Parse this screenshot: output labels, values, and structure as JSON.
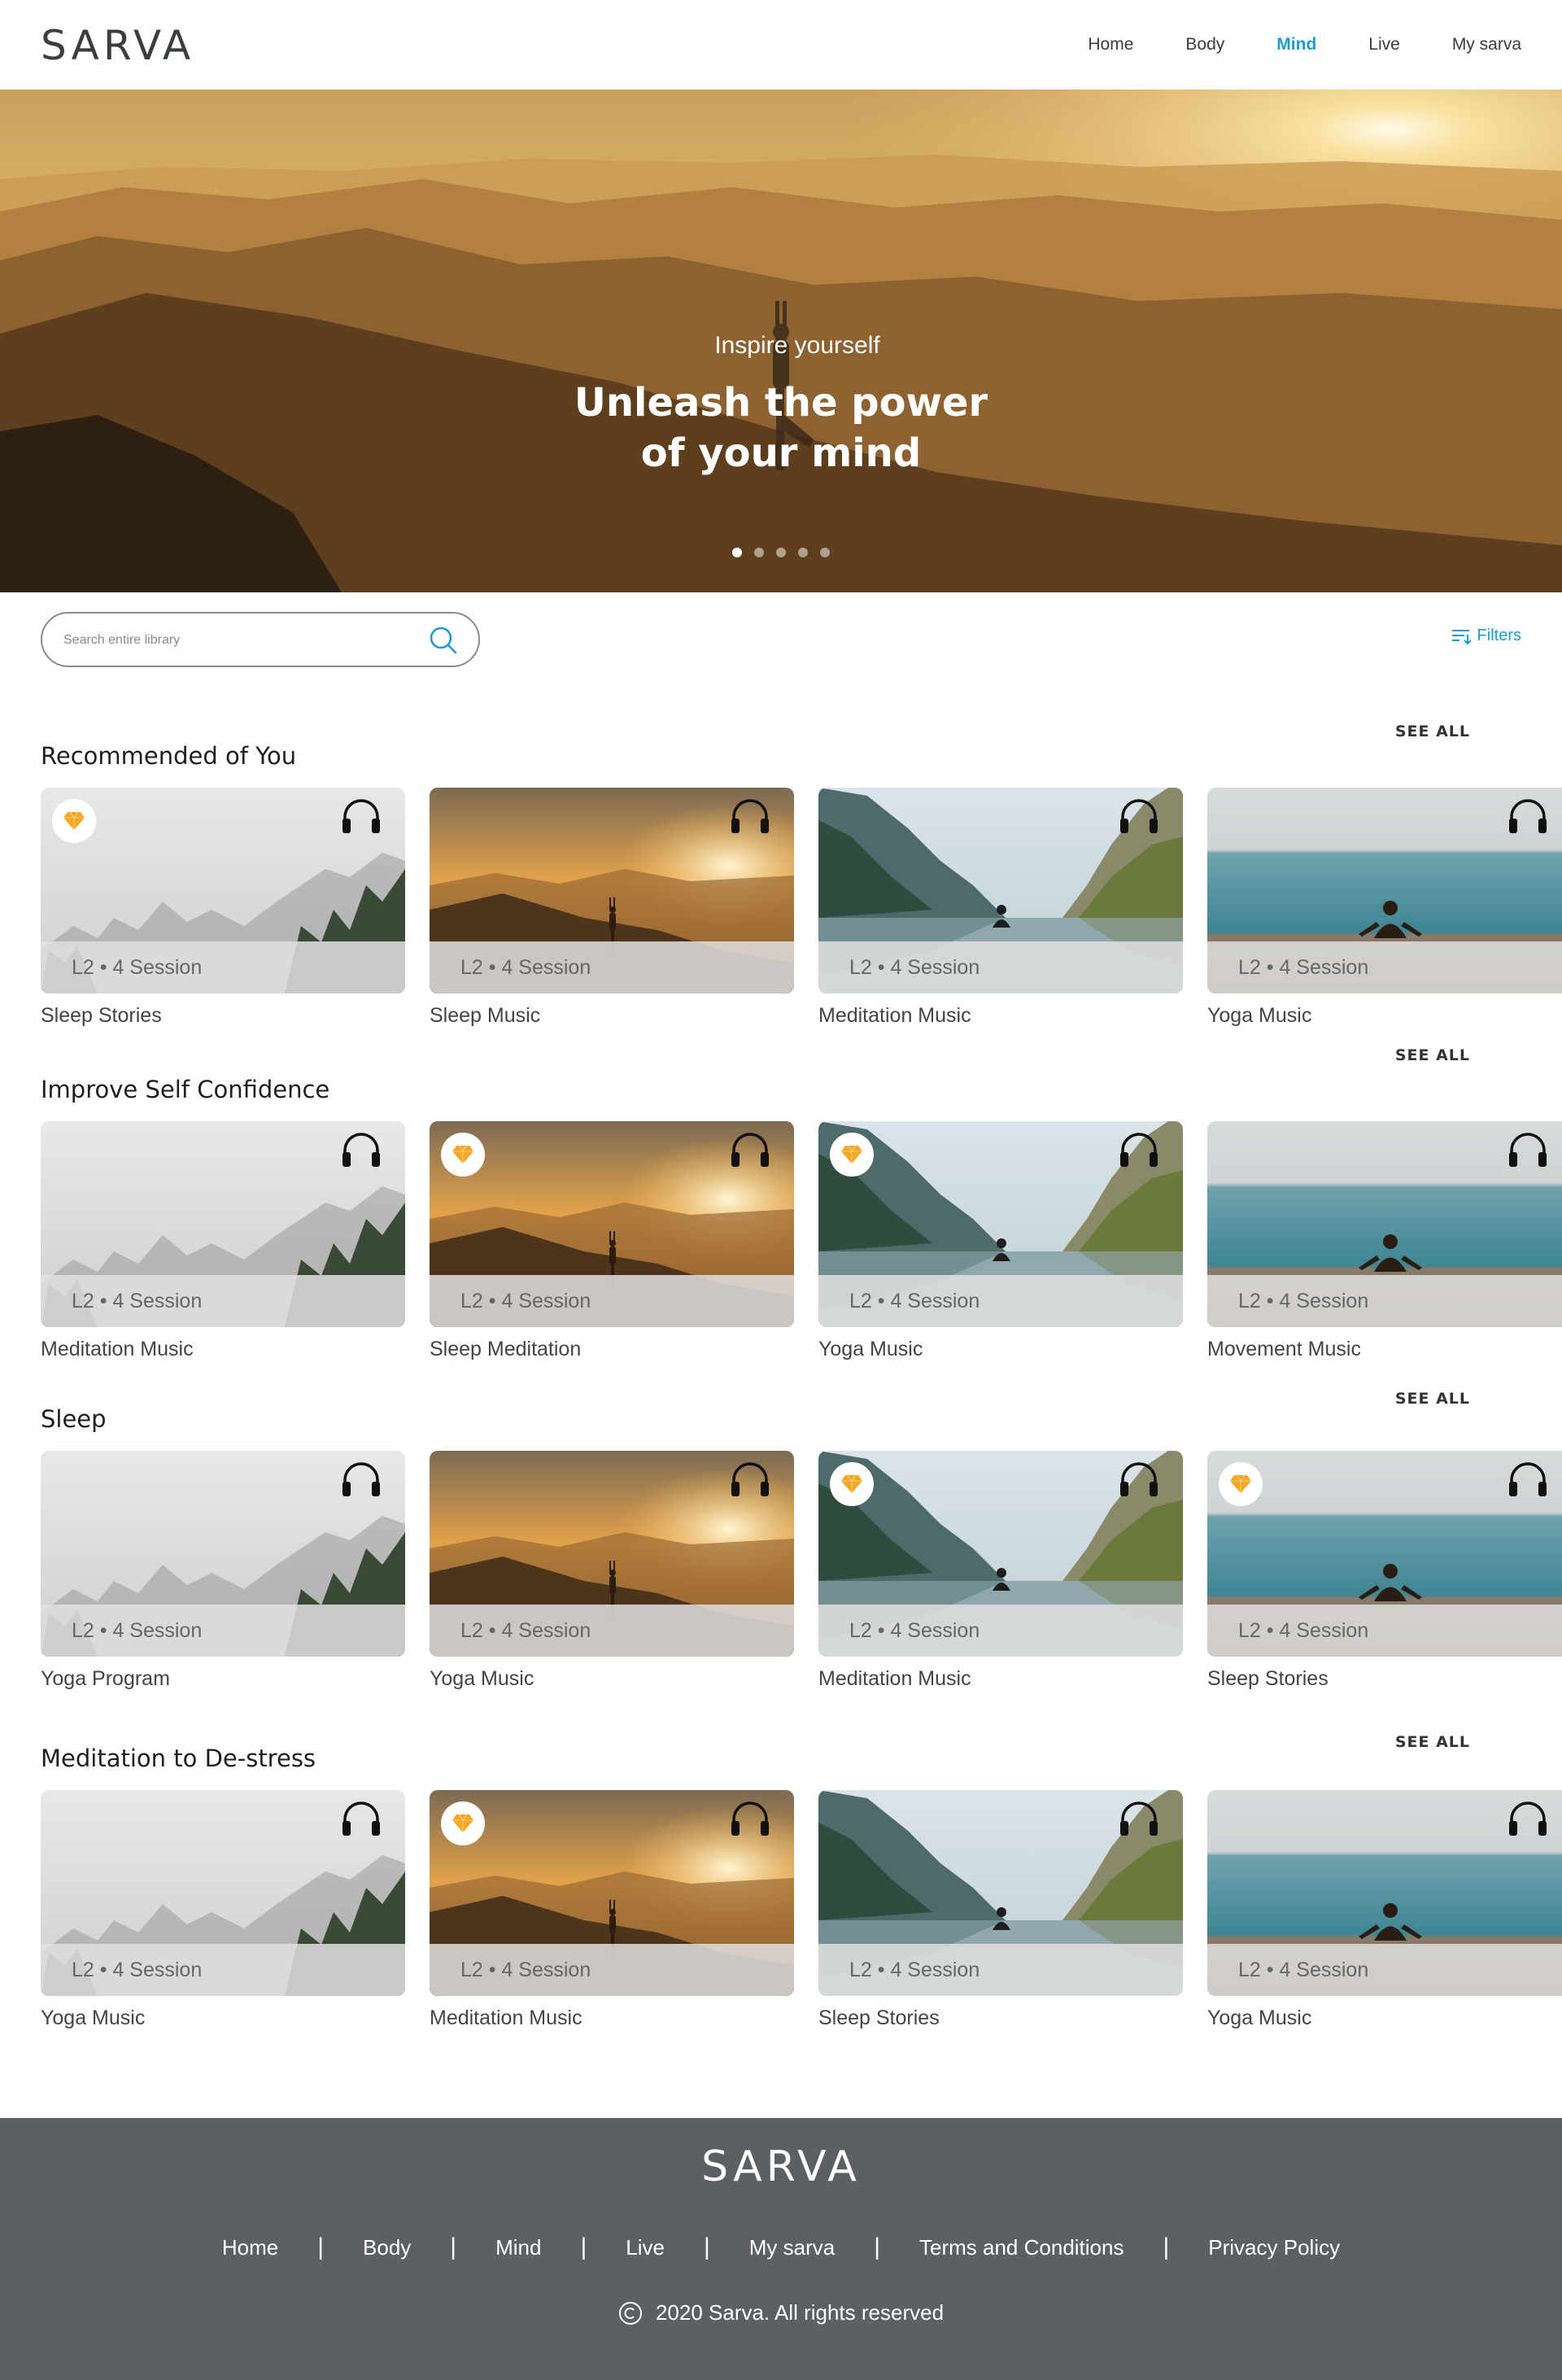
{
  "header": {
    "logo": "SARVA",
    "nav": [
      "Home",
      "Body",
      "Mind",
      "Live",
      "My sarva"
    ],
    "active_nav": "Mind"
  },
  "hero": {
    "subtitle": "Inspire yourself",
    "title_line1": "Unleash the power",
    "title_line2": "of your mind",
    "slides": 5,
    "active_slide": 1
  },
  "search": {
    "placeholder": "Search entire library",
    "icon": "search-icon"
  },
  "filters": {
    "label": "Filters",
    "icon": "filter-icon"
  },
  "sections": [
    {
      "title": "Recommended of You",
      "see_all": "SEE ALL",
      "cards": [
        {
          "title": "Sleep Stories",
          "meta": "L2  • 4 Session",
          "image": "fog-forest",
          "premium": true
        },
        {
          "title": "Sleep Music",
          "meta": "L2  • 4 Session",
          "image": "sunset-mountains",
          "premium": false
        },
        {
          "title": "Meditation Music",
          "meta": "L2  • 4 Session",
          "image": "lake-mountains",
          "premium": false
        },
        {
          "title": "Yoga Music",
          "meta": "L2  • 4 Session",
          "image": "sea-beach",
          "premium": false
        }
      ]
    },
    {
      "title": "Improve Self Confidence",
      "see_all": "SEE ALL",
      "cards": [
        {
          "title": "Meditation Music",
          "meta": "L2  • 4 Session",
          "image": "fog-forest",
          "premium": false
        },
        {
          "title": "Sleep Meditation",
          "meta": "L2  • 4 Session",
          "image": "sunset-mountains",
          "premium": true
        },
        {
          "title": "Yoga Music",
          "meta": "L2  • 4 Session",
          "image": "lake-mountains",
          "premium": true
        },
        {
          "title": "Movement Music",
          "meta": "L2  • 4 Session",
          "image": "sea-beach",
          "premium": false
        }
      ]
    },
    {
      "title": "Sleep",
      "see_all": "SEE ALL",
      "cards": [
        {
          "title": "Yoga Program",
          "meta": "L2  • 4 Session",
          "image": "fog-forest",
          "premium": false
        },
        {
          "title": "Yoga Music",
          "meta": "L2  • 4 Session",
          "image": "sunset-mountains",
          "premium": false
        },
        {
          "title": "Meditation Music",
          "meta": "L2  • 4 Session",
          "image": "lake-mountains",
          "premium": true
        },
        {
          "title": "Sleep Stories",
          "meta": "L2  • 4 Session",
          "image": "sea-beach",
          "premium": true
        }
      ]
    },
    {
      "title": "Meditation to De-stress",
      "see_all": "SEE ALL",
      "cards": [
        {
          "title": "Yoga Music",
          "meta": "L2  • 4 Session",
          "image": "fog-forest",
          "premium": false
        },
        {
          "title": "Meditation Music",
          "meta": "L2  • 4 Session",
          "image": "sunset-mountains",
          "premium": true
        },
        {
          "title": "Sleep Stories",
          "meta": "L2  • 4 Session",
          "image": "lake-mountains",
          "premium": false
        },
        {
          "title": "Yoga Music",
          "meta": "L2  • 4 Session",
          "image": "sea-beach",
          "premium": false
        }
      ]
    }
  ],
  "footer": {
    "logo": "SARVA",
    "links": [
      "Home",
      "Body",
      "Mind",
      "Live",
      "My sarva",
      "Terms and Conditions",
      "Privacy Policy"
    ],
    "copyright": "2020 Sarva. All rights reserved"
  },
  "colors": {
    "accent": "#1e9bd0",
    "premium": "#f5a623",
    "footer_bg": "#5c5f63"
  }
}
